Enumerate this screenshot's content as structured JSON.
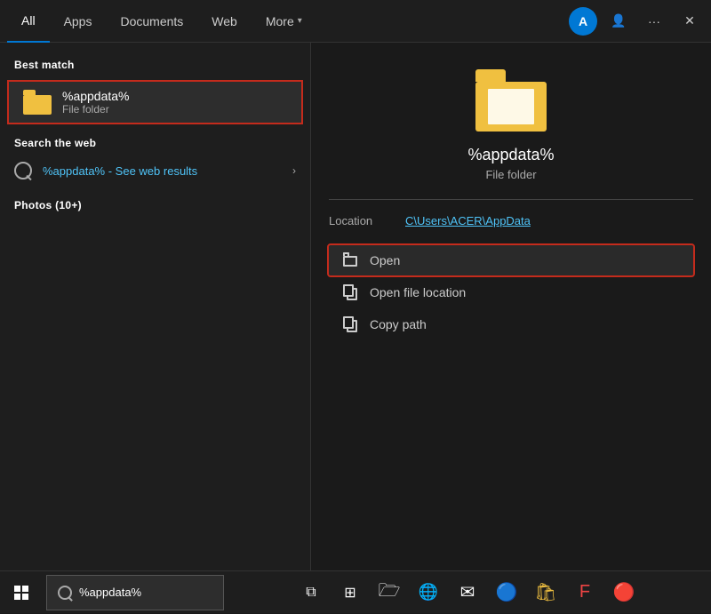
{
  "nav": {
    "tabs": [
      {
        "id": "all",
        "label": "All",
        "active": true
      },
      {
        "id": "apps",
        "label": "Apps"
      },
      {
        "id": "documents",
        "label": "Documents"
      },
      {
        "id": "web",
        "label": "Web"
      },
      {
        "id": "more",
        "label": "More"
      }
    ],
    "more_chevron": "▾",
    "avatar_initial": "A",
    "btn_person": "👤",
    "btn_more": "···",
    "btn_close": "✕"
  },
  "left": {
    "best_match_label": "Best match",
    "item_name": "%appdata%",
    "item_type": "File folder",
    "search_web_label": "Search the web",
    "web_result_query": "%appdata%",
    "web_result_suffix": " - See web results",
    "photos_label": "Photos (10+)"
  },
  "right": {
    "folder_name": "%appdata%",
    "folder_type": "File folder",
    "location_label": "Location",
    "location_value": "C\\Users\\ACER\\AppData",
    "actions": [
      {
        "id": "open",
        "label": "Open",
        "icon_type": "open"
      },
      {
        "id": "open-file-location",
        "label": "Open file location",
        "icon_type": "copy"
      },
      {
        "id": "copy-path",
        "label": "Copy path",
        "icon_type": "copy"
      }
    ]
  },
  "taskbar": {
    "search_placeholder": "%appdata%",
    "search_text": "%appdata%"
  }
}
